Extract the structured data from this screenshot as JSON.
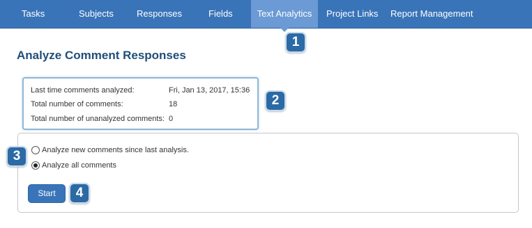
{
  "nav": {
    "tabs": [
      {
        "label": "Tasks",
        "active": false
      },
      {
        "label": "Subjects",
        "active": false
      },
      {
        "label": "Responses",
        "active": false
      },
      {
        "label": "Fields",
        "active": false
      },
      {
        "label": "Text Analytics",
        "active": true
      },
      {
        "label": "Project Links",
        "active": false
      },
      {
        "label": "Report Management",
        "active": false
      }
    ]
  },
  "callouts": [
    "1",
    "2",
    "3",
    "4"
  ],
  "page": {
    "title": "Analyze Comment Responses"
  },
  "info": {
    "rows": [
      {
        "label": "Last time comments analyzed:",
        "value": "Fri, Jan 13, 2017, 15:36"
      },
      {
        "label": "Total number of comments:",
        "value": "18"
      },
      {
        "label": "Total number of unanalyzed comments:",
        "value": "0"
      }
    ]
  },
  "options": {
    "choices": [
      {
        "label": "Analyze new comments since last analysis.",
        "checked": false
      },
      {
        "label": "Analyze all comments",
        "checked": true
      }
    ],
    "start_label": "Start"
  },
  "colors": {
    "nav_bg": "#3a74b8",
    "active_tab_bg": "#6b9ad4",
    "title": "#1f4e79",
    "badge": "#2b6aa5"
  }
}
